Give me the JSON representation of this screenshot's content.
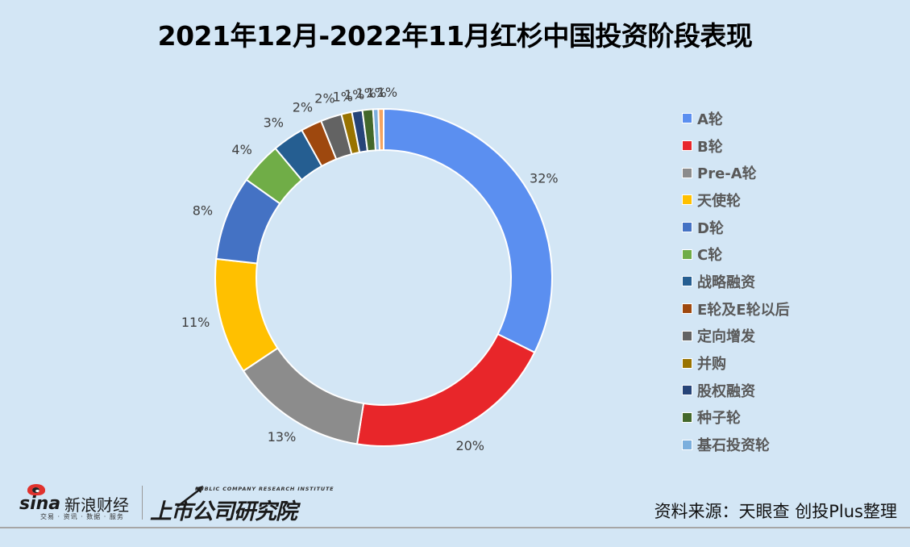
{
  "chart_data": {
    "type": "pie",
    "variant": "donut",
    "title": "2021年12月-2022年11月红杉中国投资阶段表现",
    "unit": "%",
    "start_angle_deg": 0,
    "direction": "clockwise",
    "legend_position": "right",
    "slices": [
      {
        "label": "A轮",
        "value": 32,
        "data_label": "32%",
        "color": "#5b8ff0"
      },
      {
        "label": "B轮",
        "value": 20,
        "data_label": "20%",
        "color": "#e8262a"
      },
      {
        "label": "Pre-A轮",
        "value": 13,
        "data_label": "13%",
        "color": "#8c8c8c"
      },
      {
        "label": "天使轮",
        "value": 11,
        "data_label": "11%",
        "color": "#ffc000"
      },
      {
        "label": "D轮",
        "value": 8,
        "data_label": "8%",
        "color": "#4472c4"
      },
      {
        "label": "C轮",
        "value": 4,
        "data_label": "4%",
        "color": "#70ad47"
      },
      {
        "label": "战略融资",
        "value": 3,
        "data_label": "3%",
        "color": "#255e91"
      },
      {
        "label": "E轮及E轮以后",
        "value": 2,
        "data_label": "2%",
        "color": "#9e480e"
      },
      {
        "label": "定向增发",
        "value": 2,
        "data_label": "2%",
        "color": "#636363"
      },
      {
        "label": "并购",
        "value": 1,
        "data_label": "1%",
        "color": "#997300"
      },
      {
        "label": "股权融资",
        "value": 1,
        "data_label": "1%",
        "color": "#264478"
      },
      {
        "label": "种子轮",
        "value": 1,
        "data_label": "1%",
        "color": "#43682b"
      },
      {
        "label": "基石投资轮",
        "value": 0.5,
        "data_label": "1%",
        "color": "#7cafdd"
      },
      {
        "label": "",
        "value": 0.5,
        "data_label": "1%",
        "color": "#f4a460"
      }
    ],
    "legend": [
      "A轮",
      "B轮",
      "Pre-A轮",
      "天使轮",
      "D轮",
      "C轮",
      "战略融资",
      "E轮及E轮以后",
      "定向增发",
      "并购",
      "股权融资",
      "种子轮",
      "基石投资轮"
    ]
  },
  "footer": {
    "source": "资料来源：天眼查 创投Plus整理",
    "sina_logo_word": "sina",
    "sina_logo_cn": "新浪财经",
    "sina_logo_sub": "交易 · 资讯 · 数据 · 服务",
    "institute_en": "PUBLIC COMPANY RESEARCH INSTITUTE",
    "institute_cn": "上市公司研究院"
  }
}
